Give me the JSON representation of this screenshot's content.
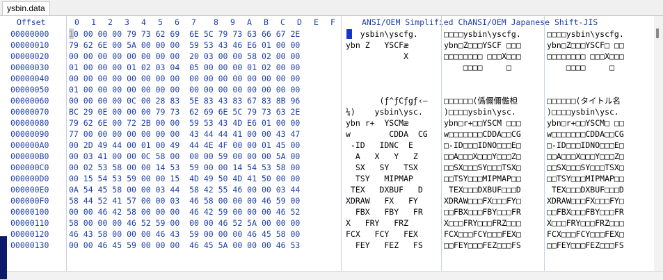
{
  "tab": {
    "label": "ysbin.data"
  },
  "header": {
    "offset": "Offset",
    "columns": [
      "0",
      "1",
      "2",
      "3",
      "4",
      "5",
      "6",
      "7",
      "8",
      "9",
      "A",
      "B",
      "C",
      "D",
      "E",
      "F"
    ],
    "encodings": "ANSI/OEM Simplified ChANSI/OEM Japanese Shift-JIS"
  },
  "rows": [
    {
      "offset": "00000000",
      "hex": "10 00 00 00 79 73 62 69  6E 5C 79 73 63 66 67 2E",
      "ansi": "   ysbin\\yscfg.",
      "simp": "□□□□ysbin\\yscfg.",
      "sjis": "□□□□ysbin\\yscfg."
    },
    {
      "offset": "00000010",
      "hex": "79 62 6E 00 5A 00 00 00  59 53 43 46 E6 01 00 00",
      "ansi": "ybn Z   YSCFæ",
      "simp": "ybn□Z□□□YSCF □□□",
      "sjis": "ybn□Z□□□YSCF□ □□"
    },
    {
      "offset": "00000020",
      "hex": "00 00 00 00 00 00 00 00  20 03 00 00 58 02 00 00",
      "ansi": "            X",
      "simp": "□□□□□□□□ □□□X□□□",
      "sjis": "□□□□□□□□ □□□X□□□"
    },
    {
      "offset": "00000030",
      "hex": "01 00 00 00 01 02 03 04  05 00 00 00 01 02 00 00",
      "ansi": "",
      "simp": "    □□□□     □",
      "sjis": "    □□□□     □"
    },
    {
      "offset": "00000040",
      "hex": "00 00 00 00 00 00 00 00  00 00 00 00 00 00 00 00",
      "ansi": "",
      "simp": "",
      "sjis": ""
    },
    {
      "offset": "00000050",
      "hex": "01 00 00 00 00 00 00 00  00 00 00 00 00 00 00 00",
      "ansi": "",
      "simp": "",
      "sjis": ""
    },
    {
      "offset": "00000060",
      "hex": "00 00 00 00 0C 00 28 83  5E 83 43 83 67 83 8B 96",
      "ansi": "       (ƒ^ƒCƒgƒ‹–",
      "simp": "□□□□□□(僞儞儞儖柦",
      "sjis": "□□□□□□(タイトル名"
    },
    {
      "offset": "00000070",
      "hex": "BC 29 0E 00 00 00 79 73  62 69 6E 5C 79 73 63 2E",
      "ansi": "¼)    ysbin\\ysc.",
      "simp": ")□□□□ysbin\\ysc.",
      "sjis": ")□□□□ysbin\\ysc."
    },
    {
      "offset": "00000080",
      "hex": "79 62 6E 00 72 2B 00 00  59 53 43 4D E6 01 00 00",
      "ansi": "ybn r+  YSCMæ",
      "simp": "ybn□r+□□YSCM □□□",
      "sjis": "ybn□r+□□YSCM□ □□"
    },
    {
      "offset": "00000090",
      "hex": "77 00 00 00 00 00 00 00  43 44 44 41 00 00 43 47",
      "ansi": "w        CDDA  CG",
      "simp": "w□□□□□□□CDDA□□CG",
      "sjis": "w□□□□□□□CDDA□□CG"
    },
    {
      "offset": "000000A0",
      "hex": "00 2D 49 44 00 01 00 49  44 4E 4F 00 00 01 45 00",
      "ansi": " -ID   IDNC  E",
      "simp": "□-ID□□□IDNO□□□E□",
      "sjis": "□-ID□□□IDNO□□□E□"
    },
    {
      "offset": "000000B0",
      "hex": "00 03 41 00 00 0C 58 00  00 00 59 00 00 00 5A 00",
      "ansi": "  A   X   Y   Z",
      "simp": "□□A□□□X□□□Y□□□Z□",
      "sjis": "□□A□□□X□□□Y□□□Z□"
    },
    {
      "offset": "000000C0",
      "hex": "00 02 53 58 00 00 14 53  59 00 00 14 54 53 58 00",
      "ansi": "  SX   SY   TSX",
      "simp": "□□SX□□□SY□□□TSX□",
      "sjis": "□□SX□□□SY□□□TSX□"
    },
    {
      "offset": "000000D0",
      "hex": "00 15 54 53 59 00 00 15  4D 49 50 4D 41 50 00 00",
      "ansi": "  TSY   MIPMAP",
      "simp": "□□TSY□□□MIPMAP□□",
      "sjis": "□□TSY□□□MIPMAP□□"
    },
    {
      "offset": "000000E0",
      "hex": "0A 54 45 58 00 00 03 44  58 42 55 46 00 00 03 44",
      "ansi": " TEX   DXBUF   D",
      "simp": " TEX□□□DXBUF□□□D",
      "sjis": " TEX□□□DXBUF□□□D"
    },
    {
      "offset": "000000F0",
      "hex": "58 44 52 41 57 00 00 03  46 58 00 00 00 46 59 00",
      "ansi": "XDRAW   FX   FY",
      "simp": "XDRAW□□□FX□□□FY□",
      "sjis": "XDRAW□□□FX□□□FY□"
    },
    {
      "offset": "00000100",
      "hex": "00 00 46 42 58 00 00 00  46 42 59 00 00 00 46 52",
      "ansi": "  FBX   FBY   FR",
      "simp": "□□FBX□□□FBY□□□FR",
      "sjis": "□□FBX□□□FBY□□□FR"
    },
    {
      "offset": "00000110",
      "hex": "58 00 00 00 46 52 59 00  00 00 46 52 5A 00 00 00",
      "ansi": "X   FRY   FRZ",
      "simp": "X□□□FRY□□□FRZ□□□",
      "sjis": "X□□□FRY□□□FRZ□□□"
    },
    {
      "offset": "00000120",
      "hex": "46 43 58 00 00 00 46 43  59 00 00 00 46 45 58 00",
      "ansi": "FCX   FCY   FEX",
      "simp": "FCX□□□FCY□□□FEX□",
      "sjis": "FCX□□□FCY□□□FEX□"
    },
    {
      "offset": "00000130",
      "hex": "00 00 46 45 59 00 00 00  46 45 5A 00 00 00 46 53",
      "ansi": "  FEY   FEZ   FS",
      "simp": "□□FEY□□□FEZ□□□FS",
      "sjis": "□□FEY□□□FEZ□□□FS"
    }
  ]
}
